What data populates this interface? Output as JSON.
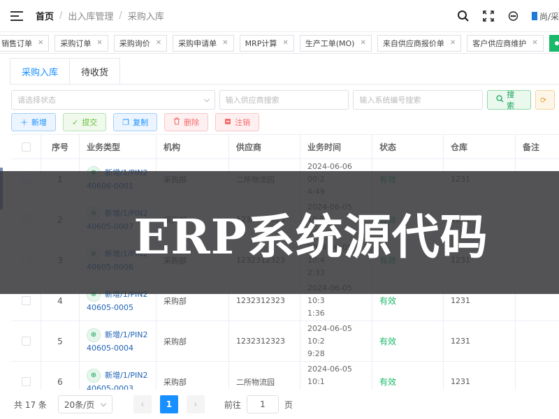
{
  "header": {
    "breadcrumb": [
      "首页",
      "出入库管理",
      "采购入库"
    ],
    "user_text": "尚/采"
  },
  "tags": [
    {
      "label": "销售订单",
      "active": false
    },
    {
      "label": "采购订单",
      "active": false
    },
    {
      "label": "采购询价",
      "active": false
    },
    {
      "label": "采购申请单",
      "active": false
    },
    {
      "label": "MRP计算",
      "active": false
    },
    {
      "label": "生产工单(MO)",
      "active": false
    },
    {
      "label": "来自供应商报价单",
      "active": false
    },
    {
      "label": "客户供应商维护",
      "active": false
    },
    {
      "label": "采",
      "active": true
    }
  ],
  "subtabs": [
    "采购入库",
    "待收货"
  ],
  "filters": {
    "status_placeholder": "请选择状态",
    "supplier_placeholder": "输入供应商搜索",
    "code_placeholder": "输入系统编号搜索",
    "search_label": "搜索"
  },
  "toolbar": {
    "add": "新增",
    "submit": "提交",
    "copy": "复制",
    "delete": "删除",
    "cancel": "注销"
  },
  "table": {
    "columns": [
      "序号",
      "业务类型",
      "机构",
      "供应商",
      "业务时间",
      "状态",
      "仓库",
      "备注"
    ],
    "rows": [
      {
        "idx": "1",
        "type1": "新增/1/PIN2",
        "type2": "40606-0001",
        "org": "采购部",
        "supplier": "二所物流园",
        "time1": "2024-06-06 00:2",
        "time2": "4:49",
        "state": "有效",
        "wh": "1231",
        "note": ""
      },
      {
        "idx": "2",
        "type1": "新增/1/PIN2",
        "type2": "40605-0007",
        "org": "采购部",
        "supplier": "1232312323",
        "time1": "2024-06-05 10:5",
        "time2": "8:37",
        "state": "有效",
        "wh": "1231",
        "note": ""
      },
      {
        "idx": "3",
        "type1": "新增/1/PIN2",
        "type2": "40605-0006",
        "org": "采购部",
        "supplier": "1232312323",
        "time1": "2024-06-05 10:4",
        "time2": "2:33",
        "state": "有效",
        "wh": "1231",
        "note": ""
      },
      {
        "idx": "4",
        "type1": "新增/1/PIN2",
        "type2": "40605-0005",
        "org": "采购部",
        "supplier": "1232312323",
        "time1": "2024-06-05 10:3",
        "time2": "1:36",
        "state": "有效",
        "wh": "1231",
        "note": ""
      },
      {
        "idx": "5",
        "type1": "新增/1/PIN2",
        "type2": "40605-0004",
        "org": "采购部",
        "supplier": "1232312323",
        "time1": "2024-06-05 10:2",
        "time2": "9:28",
        "state": "有效",
        "wh": "1231",
        "note": ""
      },
      {
        "idx": "6",
        "type1": "新增/1/PIN2",
        "type2": "40605-0003",
        "org": "采购部",
        "supplier": "二所物流园",
        "time1": "2024-06-05 10:1",
        "time2": "1:34",
        "state": "有效",
        "wh": "1231",
        "note": ""
      }
    ]
  },
  "pager": {
    "total": "共 17 条",
    "page_size": "20条/页",
    "current_page": "1",
    "goto_label": "前往",
    "goto_value": "1",
    "page_label": "页"
  },
  "banner": {
    "text": "ERP系统源代码"
  },
  "colors": {
    "accent": "#1890ff",
    "active_tag": "#19b86a",
    "state_valid": "#19b86a",
    "banner_bg": "#37373a"
  }
}
